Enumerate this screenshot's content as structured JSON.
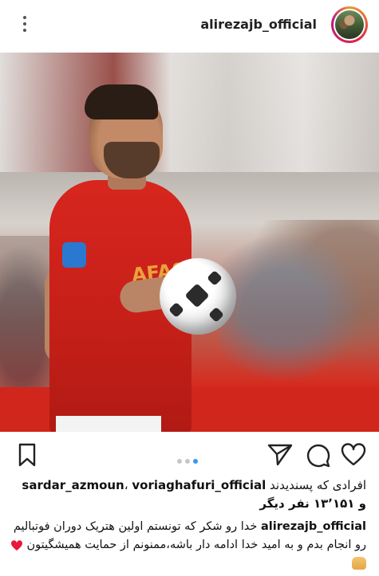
{
  "header": {
    "username": "alirezajb_official",
    "more_icon": "more-vertical-icon",
    "avatar_icon": "profile-avatar"
  },
  "photo": {
    "sponsor_text": "AFAS"
  },
  "actions": {
    "icons": [
      "bookmark-icon",
      "share-icon",
      "comment-icon",
      "heart-icon"
    ],
    "carousel_dots": 3,
    "active_dot": 3
  },
  "likes": {
    "prefix": "افرادی که پسندیدند",
    "user1": "sardar_azmoun",
    "separator": "،",
    "user2": "voriaghafuri_official",
    "count_line": "و ۱۳٬۱۵۱ نفر دیگر"
  },
  "caption": {
    "author": "alirezajb_official",
    "text": "خدا رو شکر که تونستم اولین هتریک دوران فوتبالیم رو انجام بدم و به امید خدا ادامه دار باشه،ممنونم از حمایت همیشگیتون"
  },
  "colors": {
    "accent_blue": "#3897f0",
    "heart_red": "#e8163a",
    "story_ring": "#dc2743"
  }
}
